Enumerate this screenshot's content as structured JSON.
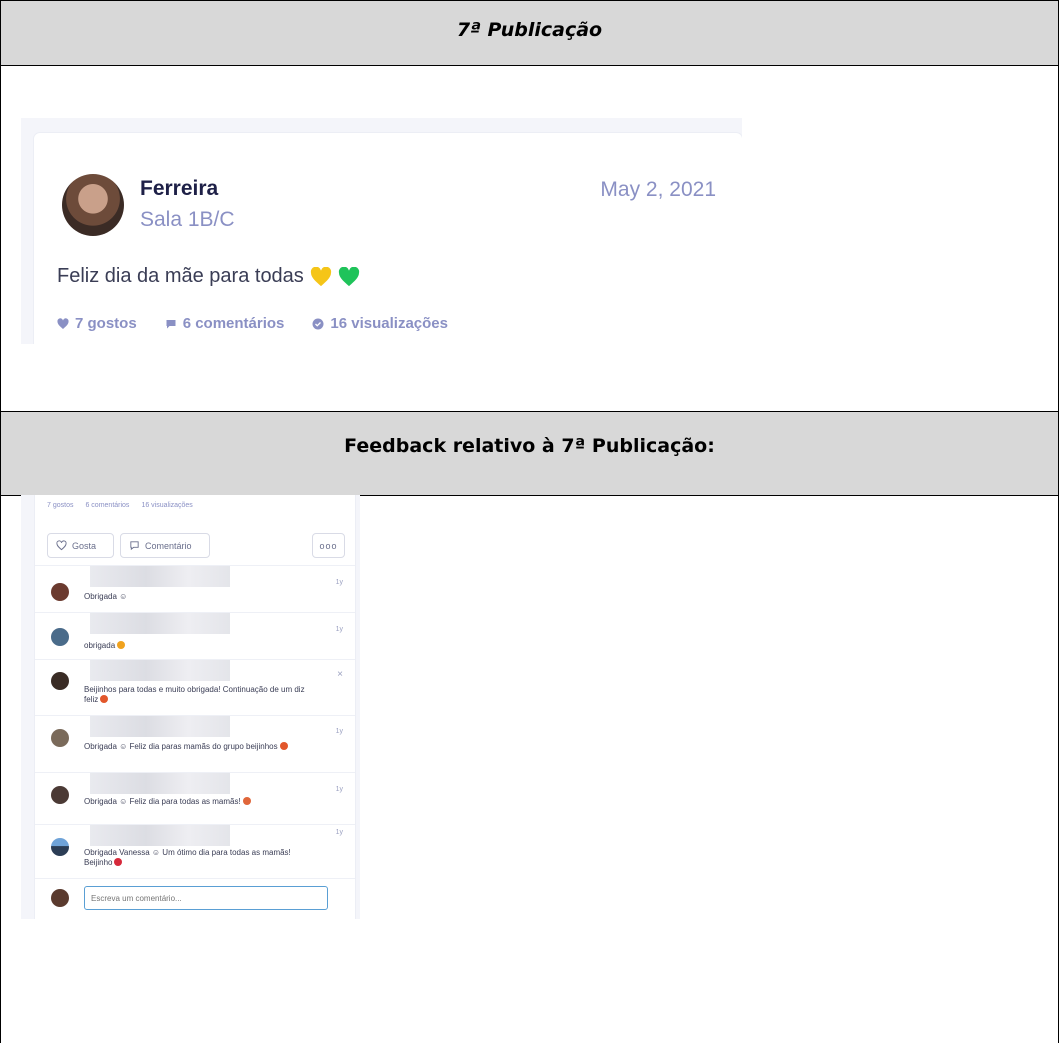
{
  "sections": [
    {
      "title": "7ª Publicação"
    },
    {
      "title": "Feedback relativo à 7ª Publicação:"
    }
  ],
  "post": {
    "author": "Ferreira",
    "room": "Sala 1B/C",
    "date": "May 2, 2021",
    "text": "Feliz dia da mãe para todas",
    "stats": {
      "likes": "7 gostos",
      "comments": "6 comentários",
      "views": "16 visualizações"
    },
    "heart_colors": [
      "#f5c518",
      "#1fc35a"
    ]
  },
  "feedback": {
    "stats": {
      "likes": "7 gostos",
      "comments": "6 comentários",
      "views": "16 visualizações"
    },
    "actions": {
      "like": "Gosta",
      "comment": "Comentário",
      "more": "ooo"
    },
    "comments": [
      {
        "text": "Obrigada ☺",
        "time": "1y"
      },
      {
        "text": "obrigada",
        "time": "1y"
      },
      {
        "text": "Beijinhos para todas e muito obrigada! Continuação de um diz feliz",
        "time": "×"
      },
      {
        "text": "Obrigada ☺ Feliz dia paras mamãs do grupo beijinhos",
        "time": "1y"
      },
      {
        "text": "Obrigada ☺ Feliz dia para todas as mamãs!",
        "time": "1y"
      },
      {
        "text": "Obrigada Vanessa ☺ Um ótimo dia para todas as mamãs! Beijinho",
        "time": "1y"
      }
    ],
    "reply_placeholder": "Escreva um comentário..."
  },
  "colors": {
    "header_bg": "#d8d8d8",
    "accent": "#8a90c4",
    "author": "#1e2047"
  }
}
